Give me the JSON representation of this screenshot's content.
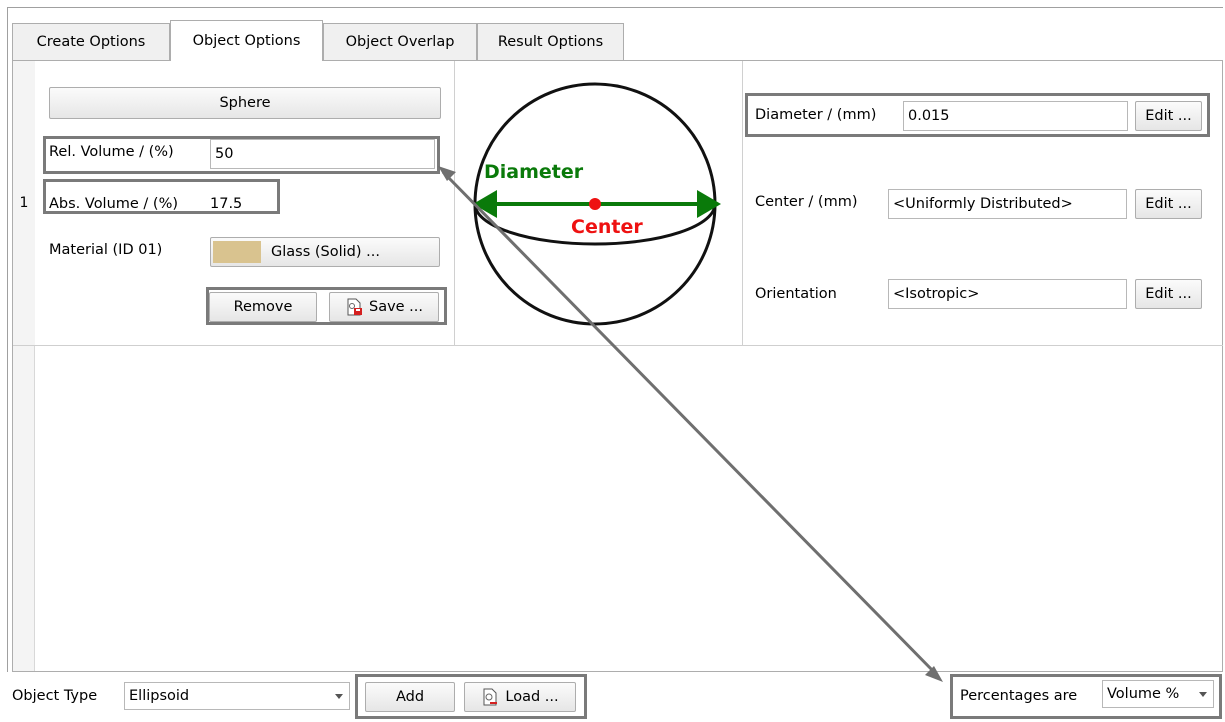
{
  "tabs": [
    {
      "label": "Create Options",
      "active": false
    },
    {
      "label": "Object Options",
      "active": true
    },
    {
      "label": "Object Overlap",
      "active": false
    },
    {
      "label": "Result Options",
      "active": false
    }
  ],
  "row": {
    "number": "1",
    "shape_button": "Sphere",
    "rel_volume_label": "Rel. Volume / (%)",
    "rel_volume_value": "50",
    "abs_volume_label": "Abs. Volume / (%)",
    "abs_volume_value": "17.5",
    "material_label": "Material (ID 01)",
    "material_button": "Glass (Solid) ...",
    "material_color": "#d9c38f",
    "remove_button": "Remove",
    "save_button": "Save ...",
    "diagram": {
      "diameter_label": "Diameter",
      "center_label": "Center",
      "diameter_color": "#0a7a0a",
      "center_color": "#ee1111"
    },
    "diameter_label": "Diameter / (mm)",
    "diameter_value": "0.015",
    "center_label": "Center / (mm)",
    "center_value": "<Uniformly Distributed>",
    "orientation_label": "Orientation",
    "orientation_value": "<Isotropic>",
    "edit_label": "Edit ..."
  },
  "bottom": {
    "object_type_label": "Object Type",
    "object_type_value": "Ellipsoid",
    "add_button": "Add",
    "load_button": "Load ...",
    "percentages_label": "Percentages are",
    "percentages_value": "Volume %"
  }
}
